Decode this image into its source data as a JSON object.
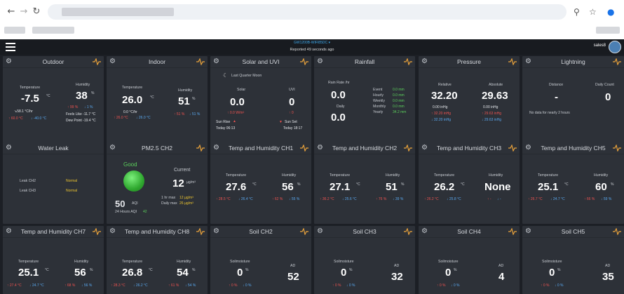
{
  "browser": {
    "icons": [
      "back-arrow-icon",
      "forward-arrow-icon",
      "reload-icon",
      "zoom-icon",
      "star-icon",
      "profile-icon"
    ]
  },
  "appbar": {
    "device": "GW1200B-WIFI85DC",
    "reported": "Reported 49 seconds ago",
    "user": "sales8"
  },
  "outdoor": {
    "title": "Outdoor",
    "temp_label": "Temperature",
    "temp": "-7.5",
    "temp_unit": "°C",
    "hum_label": "Humidity",
    "hum": "38",
    "hum_unit": "%",
    "hum_max": "↑ 99 %",
    "hum_min": "↓ 1 %",
    "rate": "↘58.1 °C/hr",
    "feels": "Feels Like  -11.7 °C",
    "dew": "Dew Point  -19.4 °C",
    "tmax": "↑ 60.0 °C",
    "tmin": "↓ -40.0 °C"
  },
  "indoor": {
    "title": "Indoor",
    "temp_label": "Temperature",
    "temp": "26.0",
    "temp_unit": "°C",
    "hum_label": "Humidity",
    "hum": "51",
    "hum_unit": "%",
    "rate": "0.0 °C/hr",
    "tmax": "↑ 26.0 °C",
    "tmin": "↓ 26.0 °C",
    "hmax": "↑ 51 %",
    "hmin": "↓ 51 %"
  },
  "solar": {
    "title": "Solar and UVI",
    "moon": "Last Quarter Moon",
    "solar_label": "Solar",
    "solar": "0.0",
    "uvi_label": "UVI",
    "uvi": "0",
    "solar_max": "↑ 0.0 W/m²",
    "uvi_max": "↑ 0",
    "sunrise_label": "Sun Rise",
    "sunrise": "Today 06:13",
    "sunset_label": "Sun Set",
    "sunset": "Today 18:17"
  },
  "rain": {
    "title": "Rainfall",
    "rate_label": "Rain Rate /hr",
    "rate": "0.0",
    "daily_label": "Daily",
    "daily": "0.0",
    "rows": [
      {
        "k": "Event",
        "v": "0.0 mm"
      },
      {
        "k": "Hourly",
        "v": "0.0 mm"
      },
      {
        "k": "Weekly",
        "v": "0.0 mm"
      },
      {
        "k": "Monthly",
        "v": "0.0 mm"
      },
      {
        "k": "Yearly",
        "v": "34.2 mm"
      }
    ]
  },
  "pressure": {
    "title": "Pressure",
    "rel_label": "Relative",
    "rel": "32.20",
    "abs_label": "Absolute",
    "abs": "29.63",
    "rel_rate": "0.00 inHg",
    "abs_rate": "0.00 inHg",
    "rel_max": "↑ 32.20 inHg",
    "rel_min": "↓ 32.20 inHg",
    "abs_max": "↑ 29.63 inHg",
    "abs_min": "↓ 29.63 inHg"
  },
  "lightning": {
    "title": "Lightning",
    "dist_label": "Distance",
    "dist": "-",
    "count_label": "Daily Count",
    "count": "0",
    "note": "No data for nearly 2 hours"
  },
  "leak": {
    "title": "Water Leak",
    "rows": [
      {
        "k": "Leak CH2",
        "v": "Normal"
      },
      {
        "k": "Leak CH3",
        "v": "Normal"
      }
    ]
  },
  "pm25": {
    "title": "PM2.5 CH2",
    "status": "Good",
    "current_label": "Current",
    "current": "12",
    "unit": "µg/m³",
    "max1_label": "1 hr max",
    "max1": "12 µg/m³",
    "dmax_label": "Daily max",
    "dmax": "26 µg/m³",
    "aqi": "50",
    "aqi_unit": "AQI",
    "aqi24_label": "24 Hours AQI",
    "aqi24": "42"
  },
  "th": [
    {
      "title": "Temp and Humidity CH1",
      "temp": "27.6",
      "hum": "56",
      "tmax": "↑ 28.5 °C",
      "tmin": "↓ 26.4 °C",
      "hmax": "↑ 62 %",
      "hmin": "↓ 55 %"
    },
    {
      "title": "Temp and Humidity CH2",
      "temp": "27.1",
      "hum": "51",
      "tmax": "↑ 36.2 °C",
      "tmin": "↓ 25.6 °C",
      "hmax": "↑ 76 %",
      "hmin": "↓ 39 %"
    },
    {
      "title": "Temp and Humidity CH3",
      "temp": "26.2",
      "hum": "None",
      "tmax": "↑ 26.2 °C",
      "tmin": "↓ 25.8 °C",
      "hmax": "↑ -",
      "hmin": "↓ -"
    },
    {
      "title": "Temp and Humidity CH5",
      "temp": "25.1",
      "hum": "60",
      "tmax": "↑ 26.7 °C",
      "tmin": "↓ 24.7 °C",
      "hmax": "↑ 66 %",
      "hmin": "↓ 59 %"
    },
    {
      "title": "Temp and Humidity CH7",
      "temp": "25.1",
      "hum": "56",
      "tmax": "↑ 27.4 °C",
      "tmin": "↓ 24.7 °C",
      "hmax": "↑ 68 %",
      "hmin": "↓ 56 %"
    },
    {
      "title": "Temp and Humidity CH8",
      "temp": "26.8",
      "hum": "54",
      "tmax": "↑ 28.3 °C",
      "tmin": "↓ 26.2 °C",
      "hmax": "↑ 61 %",
      "hmin": "↓ 54 %"
    }
  ],
  "th_labels": {
    "temp": "Temperature",
    "hum": "Humidity",
    "temp_unit": "°C",
    "hum_unit": "%"
  },
  "soil": [
    {
      "title": "Soil CH2",
      "val": "0",
      "ad": "52",
      "max": "↑ 0 %",
      "min": "↓ 0 %"
    },
    {
      "title": "Soil CH3",
      "val": "0",
      "ad": "32",
      "max": "↑ 0 %",
      "min": "↓ 0 %"
    },
    {
      "title": "Soil CH4",
      "val": "0",
      "ad": "4",
      "max": "↑ 0 %",
      "min": "↓ 0 %"
    },
    {
      "title": "Soil CH5",
      "val": "0",
      "ad": "35",
      "max": "↑ 0 %",
      "min": "↓ 0 %"
    }
  ],
  "soil_labels": {
    "moist": "Soilmoisture",
    "ad": "AD",
    "unit": "%"
  }
}
